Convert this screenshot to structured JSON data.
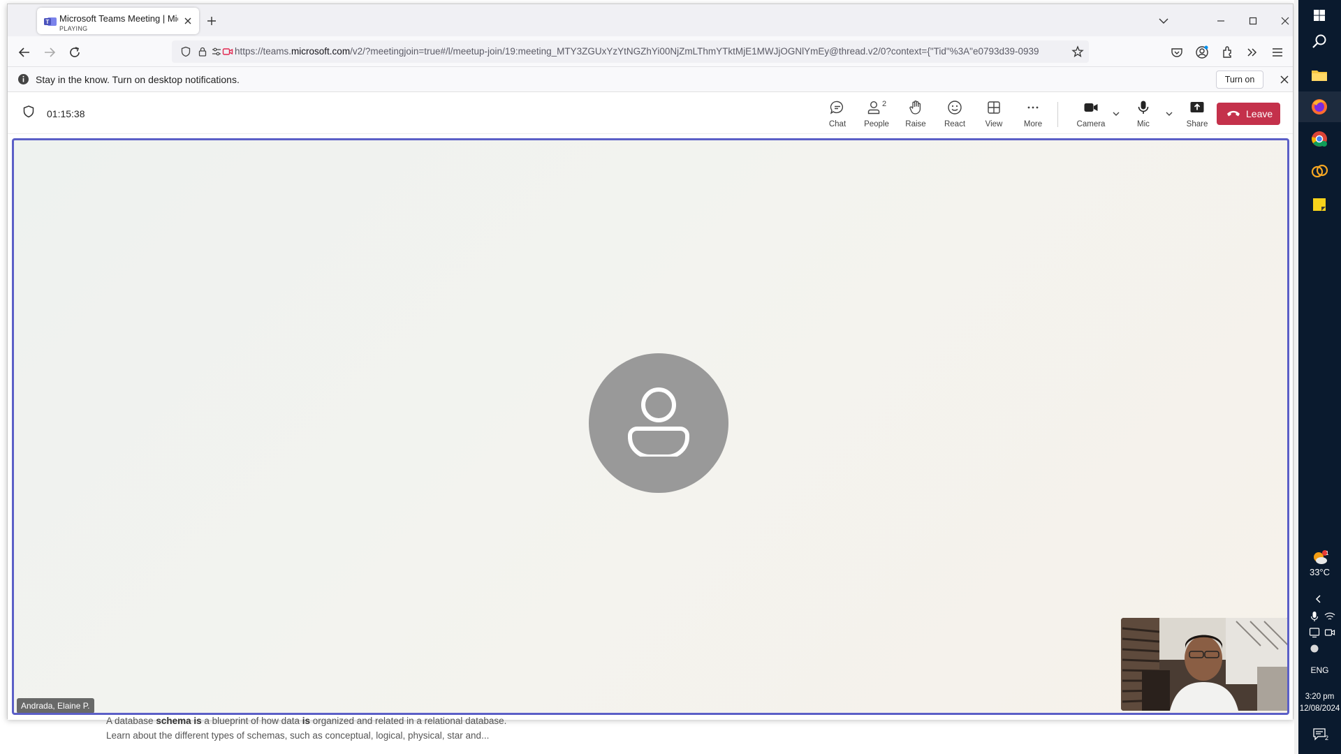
{
  "browser": {
    "tab": {
      "title": "Microsoft Teams Meeting | Microsoft Teams",
      "status": "PLAYING"
    },
    "url": {
      "prefix": "https://teams.",
      "domain": "microsoft.com",
      "rest": "/v2/?meetingjoin=true#/l/meetup-join/19:meeting_MTY3ZGUxYzYtNGZhYi00NjZmLThmYTktMjE1MWJjOGNlYmEy@thread.v2/0?context={\"Tid\"%3A\"e0793d39-0939"
    }
  },
  "notification": {
    "text": "Stay in the know. Turn on desktop notifications.",
    "button_label": "Turn on"
  },
  "meeting": {
    "timer": "01:15:38",
    "controls": {
      "chat": "Chat",
      "people": "People",
      "people_count": "2",
      "raise": "Raise",
      "react": "React",
      "view": "View",
      "more": "More",
      "camera": "Camera",
      "mic": "Mic",
      "share": "Share",
      "leave": "Leave"
    },
    "participant_name": "Andrada, Elaine P."
  },
  "background_page": {
    "line1_pre": "A database ",
    "line1_bold1": "schema is",
    "line1_mid": " a blueprint of how data ",
    "line1_bold2": "is",
    "line1_post": " organized and related in a relational database.",
    "line2": "Learn about the different types of schemas, such as conceptual, logical, physical, star and..."
  },
  "taskbar": {
    "weather_temp": "33°C",
    "weather_badge": "1",
    "language": "ENG",
    "time": "3:20 pm",
    "date": "12/08/2024",
    "notification_count": "2"
  },
  "colors": {
    "accent": "#5b5fc7",
    "leave": "#c4314b",
    "taskbar": "#0a1a2e"
  }
}
